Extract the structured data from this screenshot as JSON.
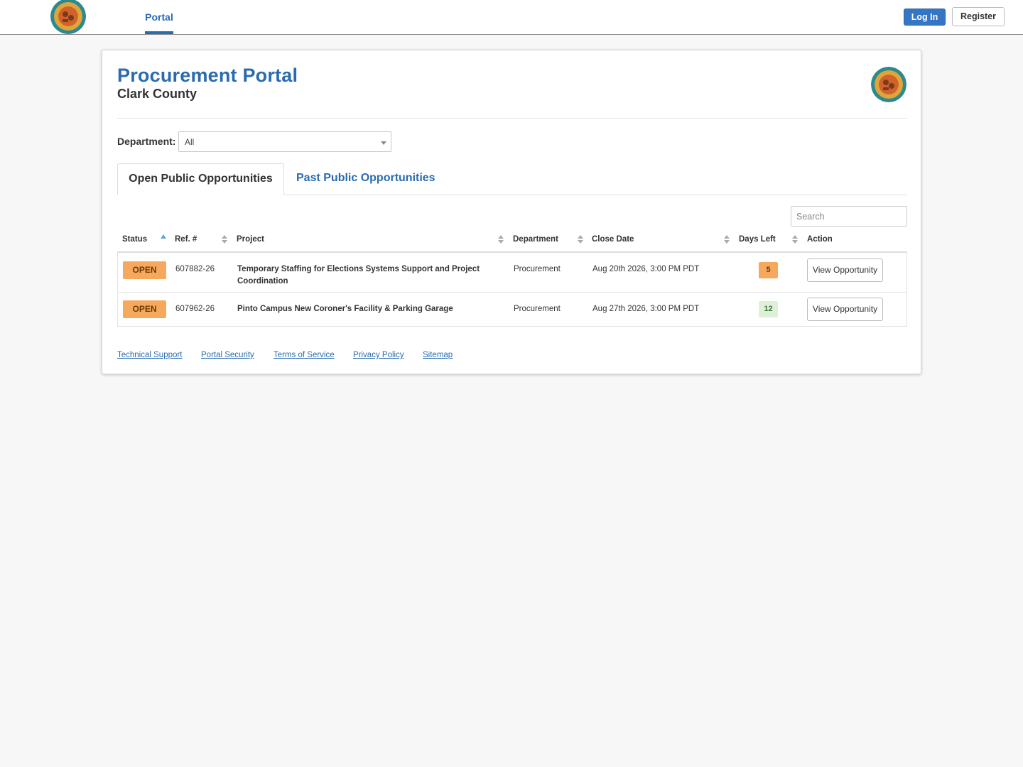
{
  "nav": {
    "active_tab": "Portal",
    "login_label": "Log In",
    "register_label": "Register"
  },
  "header": {
    "title": "Procurement Portal",
    "subtitle": "Clark County"
  },
  "filter": {
    "label": "Department:",
    "selected": "All"
  },
  "tabs": [
    {
      "label": "Open Public Opportunities",
      "active": true
    },
    {
      "label": "Past Public Opportunities",
      "active": false
    }
  ],
  "search": {
    "placeholder": "Search"
  },
  "table": {
    "columns": [
      "Status",
      "Ref. #",
      "Project",
      "Department",
      "Close Date",
      "Days Left",
      "Action"
    ],
    "rows": [
      {
        "status": "OPEN",
        "ref": "607882-26",
        "project_line1": "Temporary Staffing for Elections Systems Support and Project",
        "project_line2": "Coordination",
        "department": "Procurement",
        "close_date": "Aug 20th 2026, 3:00 PM PDT",
        "days_left": "5",
        "action": "View Opportunity"
      },
      {
        "status": "OPEN",
        "ref": "607962-26",
        "project_line1": "Pinto Campus New Coroner's Facility & Parking Garage",
        "project_line2": "",
        "department": "Procurement",
        "close_date": "Aug 27th 2026, 3:00 PM PDT",
        "days_left": "12",
        "action": "View Opportunity"
      }
    ]
  },
  "footer": {
    "links": [
      "Technical Support",
      "Portal Security",
      "Terms of Service",
      "Privacy Policy",
      "Sitemap"
    ]
  },
  "colors": {
    "brand_blue": "#2a6bb0",
    "login_blue": "#3576c4",
    "open_orange": "#f6a85d",
    "days_green_bg": "#dff0d8"
  },
  "icons": {
    "seal": "county-seal-icon",
    "sort": "sort-arrows-icon",
    "dropdown": "chevron-down-icon"
  }
}
